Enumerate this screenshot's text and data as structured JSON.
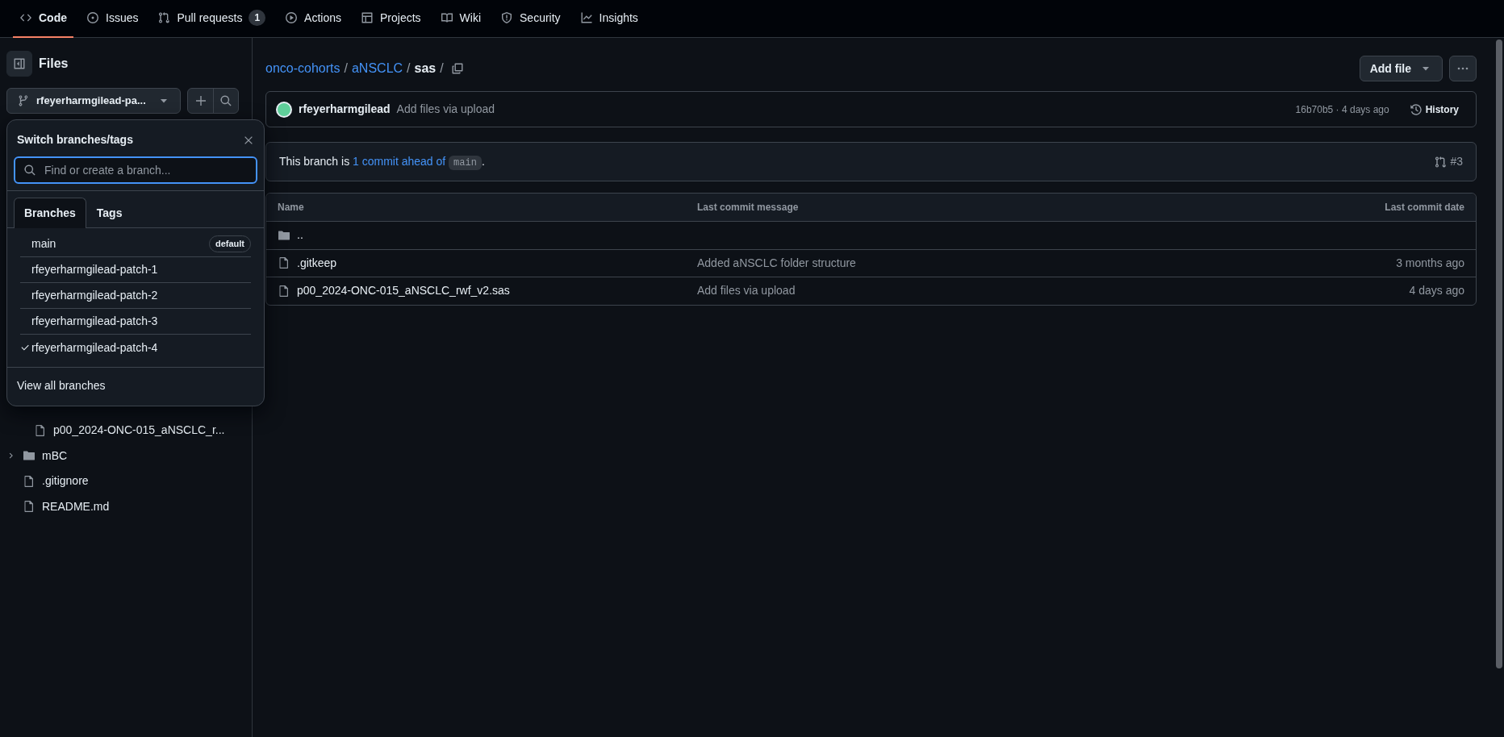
{
  "nav_tabs": [
    {
      "label": "Code",
      "selected": true
    },
    {
      "label": "Issues",
      "selected": false
    },
    {
      "label": "Pull requests",
      "selected": false,
      "count": "1"
    },
    {
      "label": "Actions",
      "selected": false
    },
    {
      "label": "Projects",
      "selected": false
    },
    {
      "label": "Wiki",
      "selected": false
    },
    {
      "label": "Security",
      "selected": false
    },
    {
      "label": "Insights",
      "selected": false
    }
  ],
  "sidebar": {
    "title": "Files",
    "branch_button": "rfeyerharmgilead-pa...",
    "tree": [
      {
        "kind": "group",
        "children": [
          {
            "kind": "file",
            "name": "p00_2024-ONC-015_aNSCLC_r..."
          }
        ]
      },
      {
        "kind": "folder",
        "name": "mBC",
        "expanded": false
      },
      {
        "kind": "file",
        "name": ".gitignore"
      },
      {
        "kind": "file",
        "name": "README.md"
      }
    ]
  },
  "branch_popup": {
    "title": "Switch branches/tags",
    "search": {
      "placeholder": "Find or create a branch..."
    },
    "tabs": [
      {
        "label": "Branches",
        "selected": true
      },
      {
        "label": "Tags",
        "selected": false
      }
    ],
    "branches": [
      {
        "name": "main",
        "checked": false,
        "badge": "default"
      },
      {
        "name": "rfeyerharmgilead-patch-1",
        "checked": false
      },
      {
        "name": "rfeyerharmgilead-patch-2",
        "checked": false
      },
      {
        "name": "rfeyerharmgilead-patch-3",
        "checked": false
      },
      {
        "name": "rfeyerharmgilead-patch-4",
        "checked": true
      }
    ],
    "footer": "View all branches"
  },
  "breadcrumb": [
    {
      "label": "onco-cohorts",
      "kind": "link",
      "separator": "/"
    },
    {
      "label": "aNSCLC",
      "kind": "link",
      "separator": "/"
    },
    {
      "label": "sas",
      "kind": "current",
      "separator": "/"
    }
  ],
  "add_file_button": "Add file",
  "commit": {
    "author": "rfeyerharmgilead",
    "message": "Add files via upload",
    "meta": "16b70b5 · 4 days ago",
    "history": "History"
  },
  "branch_status": {
    "text": "This branch is ",
    "link": "1 commit ahead of",
    "base": "main",
    "end": ".",
    "pull_request": "#3"
  },
  "table": {
    "columns": [
      "Name",
      "Last commit message",
      "Last commit date"
    ],
    "rows": [
      {
        "kind": "parent",
        "name": ".."
      },
      {
        "kind": "file",
        "name": ".gitkeep",
        "message": "Added aNSCLC folder structure",
        "date": "3 months ago"
      },
      {
        "kind": "file",
        "name": "p00_2024-ONC-015_aNSCLC_rwf_v2.sas",
        "message": "Add files via upload",
        "date": "4 days ago"
      }
    ]
  }
}
